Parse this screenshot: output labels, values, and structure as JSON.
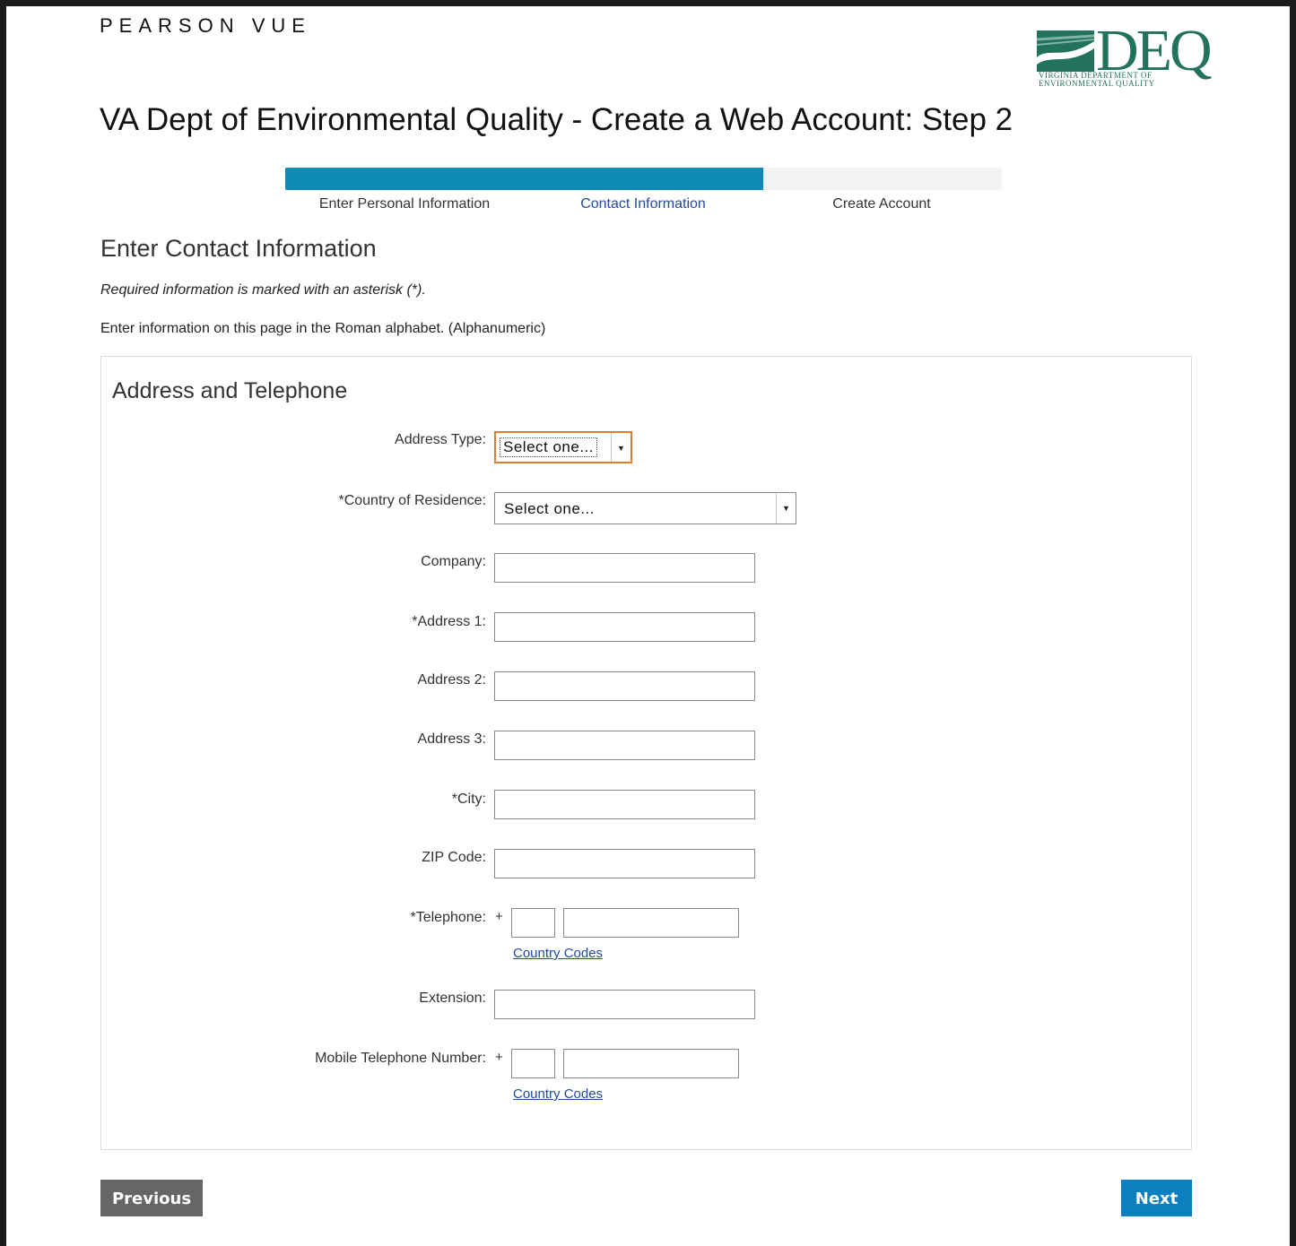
{
  "brand": "PEARSON VUE",
  "logo": {
    "text": "DEQ",
    "subtitle_line1": "VIRGINIA DEPARTMENT OF",
    "subtitle_line2": "ENVIRONMENTAL QUALITY",
    "color": "#23725e"
  },
  "page_title": "VA Dept of Environmental Quality - Create a Web Account: Step 2",
  "progress": {
    "fraction_complete": 0.667,
    "fill_color": "#0d8ab5",
    "steps": [
      {
        "label": "Enter Personal Information"
      },
      {
        "label": "Contact Information"
      },
      {
        "label": "Create Account"
      }
    ]
  },
  "section_title": "Enter Contact Information",
  "required_note": "Required information is marked with an asterisk (*).",
  "alphabet_note": "Enter information on this page in the Roman alphabet. (Alphanumeric)",
  "panel": {
    "title": "Address and Telephone",
    "fields": {
      "address_type": {
        "label": "Address Type:",
        "value": "Select one..."
      },
      "country": {
        "label": "*Country of Residence:",
        "value": "Select one..."
      },
      "company": {
        "label": "Company:",
        "value": ""
      },
      "address1": {
        "label": "*Address 1:",
        "value": ""
      },
      "address2": {
        "label": "Address 2:",
        "value": ""
      },
      "address3": {
        "label": "Address 3:",
        "value": ""
      },
      "city": {
        "label": "*City:",
        "value": ""
      },
      "zip": {
        "label": "ZIP Code:",
        "value": ""
      },
      "telephone": {
        "label": "*Telephone:",
        "plus": "+",
        "link": "Country Codes"
      },
      "extension": {
        "label": "Extension:",
        "value": ""
      },
      "mobile": {
        "label": "Mobile Telephone Number:",
        "plus": "+",
        "link": "Country Codes"
      }
    }
  },
  "buttons": {
    "previous": "Previous",
    "next": "Next"
  },
  "icons": {
    "dropdown_arrow": "caret-down-icon"
  },
  "colors": {
    "link": "#214b9b",
    "next_button": "#0c80bf",
    "previous_button": "#666666",
    "focus_outline": "#e07a2c"
  }
}
